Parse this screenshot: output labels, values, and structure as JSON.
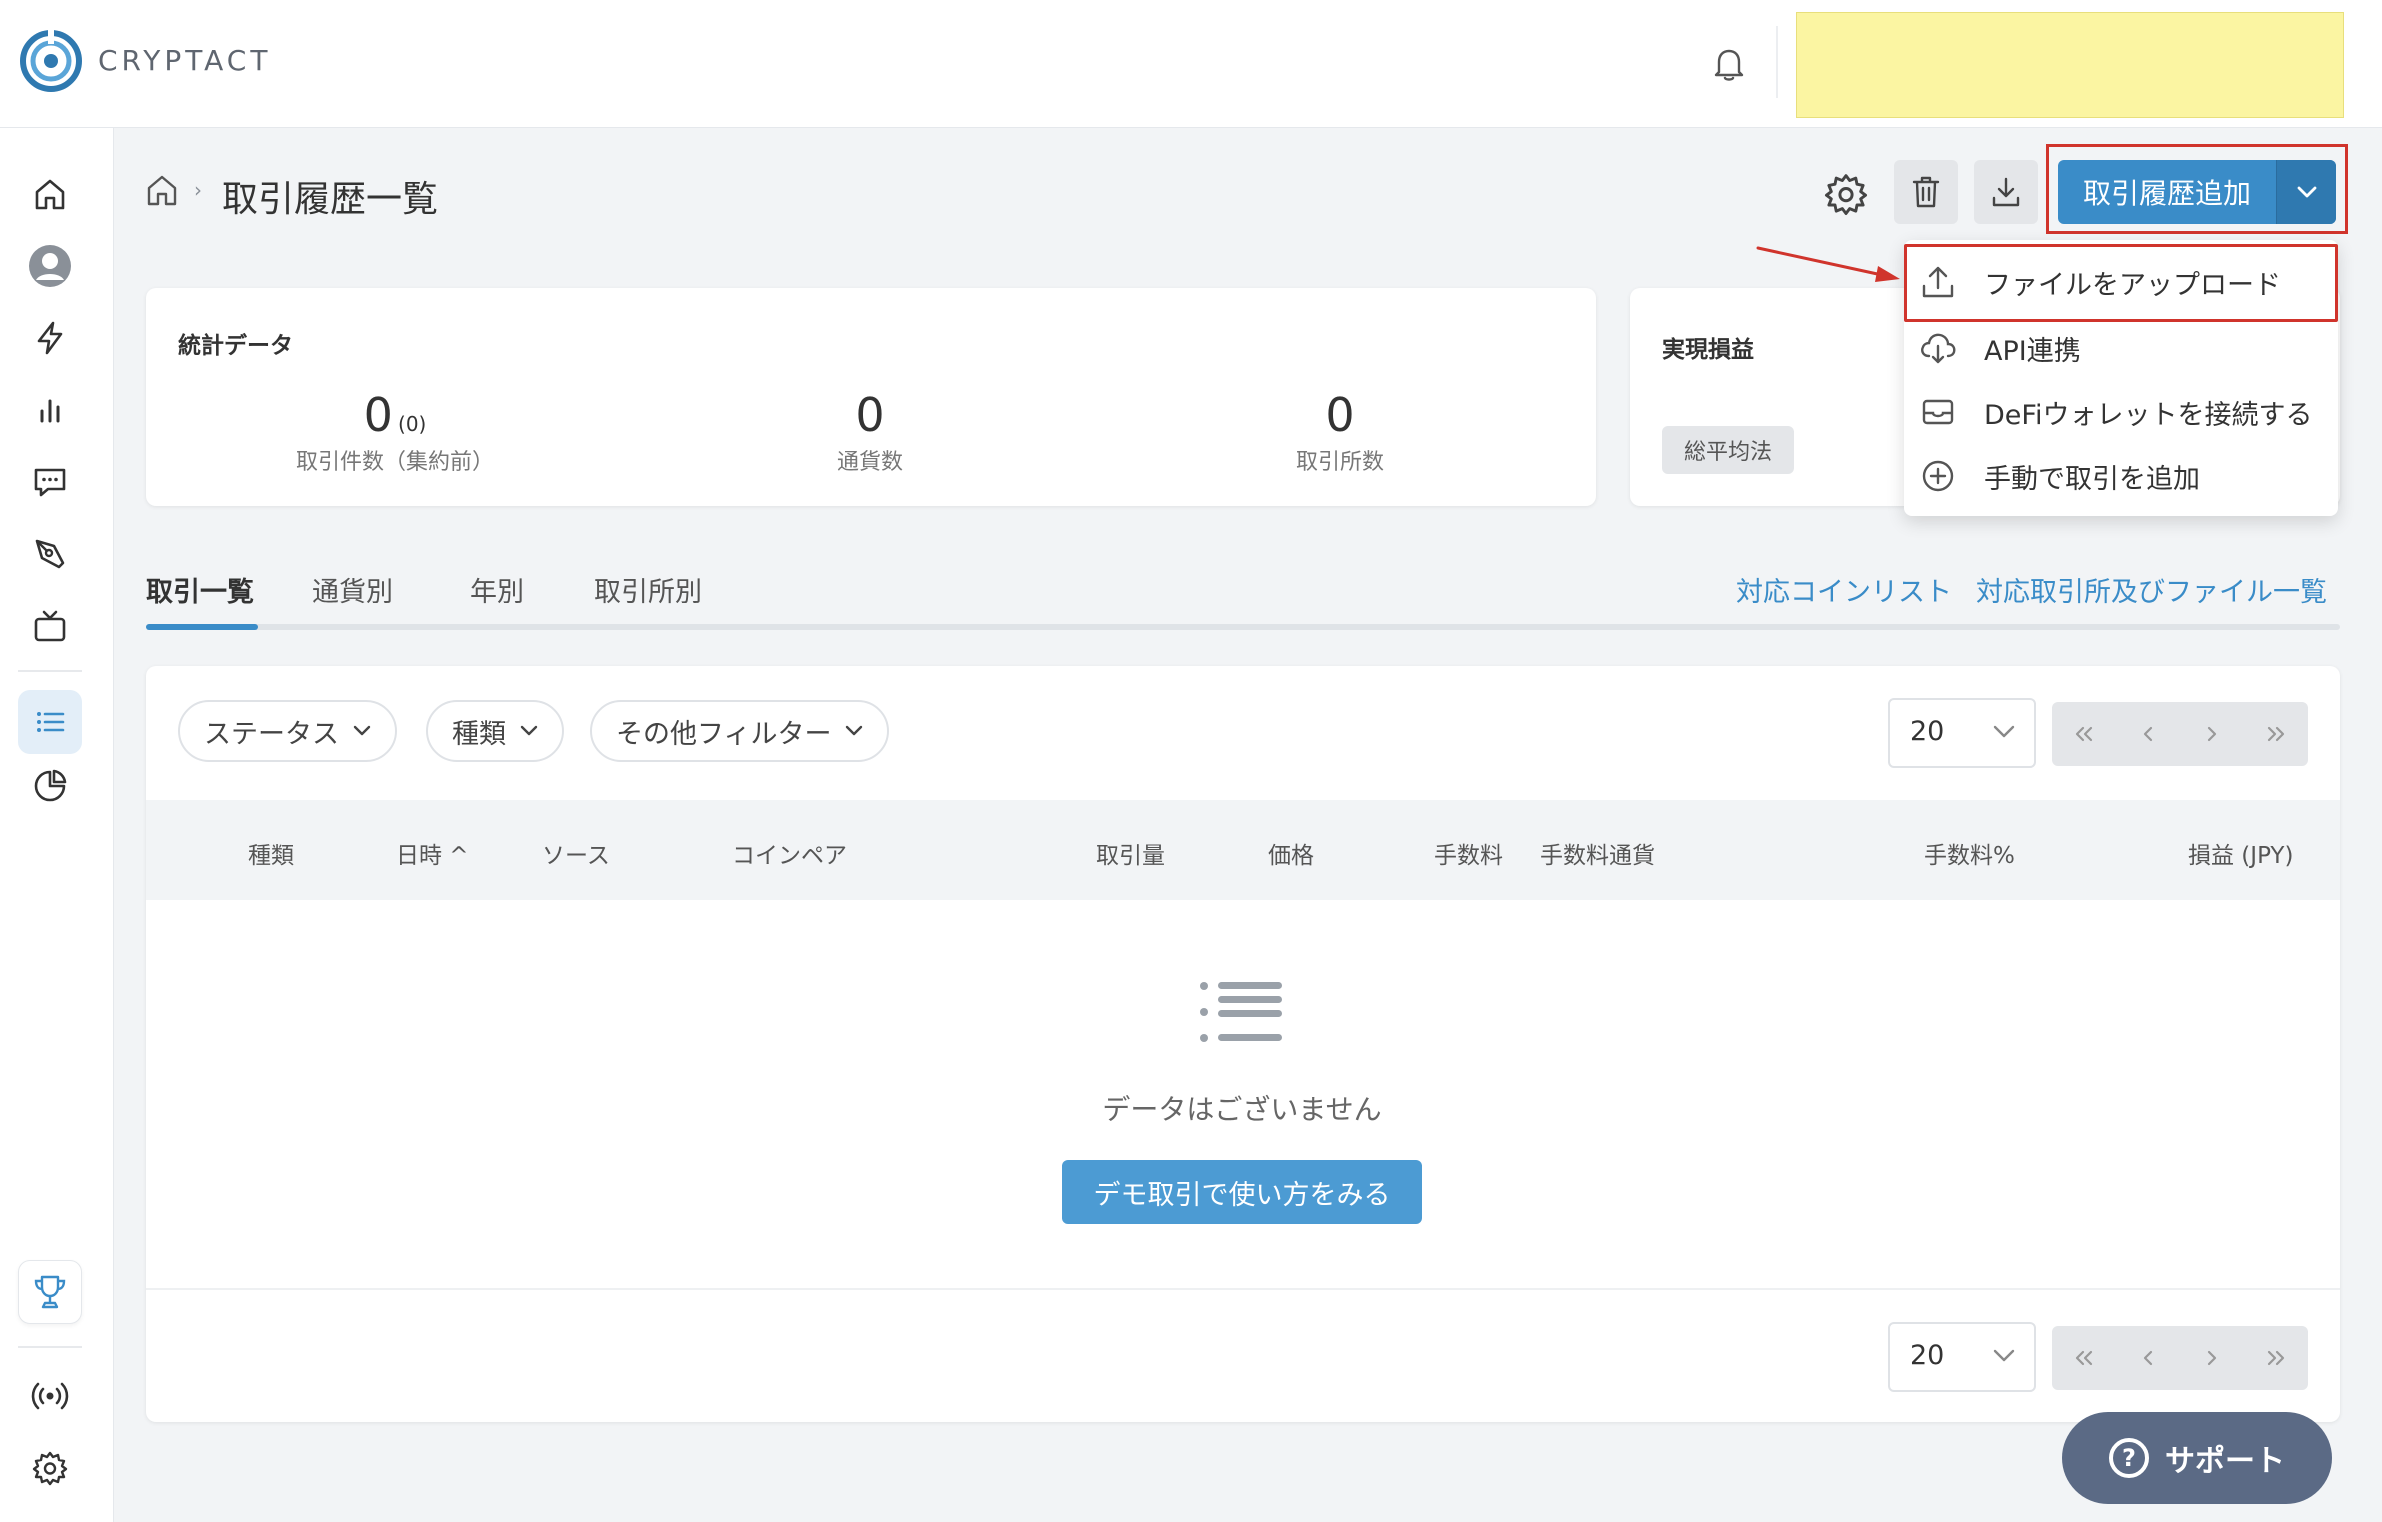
{
  "brand": {
    "name": "CRYPTACT"
  },
  "breadcrumb": {
    "title": "取引履歴一覧"
  },
  "toolbar": {
    "add_button_label": "取引履歴追加"
  },
  "add_menu": {
    "items": [
      {
        "label": "ファイルをアップロード",
        "icon": "upload-icon"
      },
      {
        "label": "API連携",
        "icon": "cloud-download-icon"
      },
      {
        "label": "DeFiウォレットを接続する",
        "icon": "wallet-icon"
      },
      {
        "label": "手動で取引を追加",
        "icon": "plus-circle-icon"
      }
    ]
  },
  "stats_card": {
    "title": "統計データ",
    "stats": [
      {
        "value": "0",
        "sub": "(0)",
        "label": "取引件数（集約前）"
      },
      {
        "value": "0",
        "label": "通貨数"
      },
      {
        "value": "0",
        "label": "取引所数"
      }
    ]
  },
  "pnl_card": {
    "title": "実現損益",
    "method": "総平均法"
  },
  "tabs": [
    {
      "label": "取引一覧",
      "active": true
    },
    {
      "label": "通貨別",
      "active": false
    },
    {
      "label": "年別",
      "active": false
    },
    {
      "label": "取引所別",
      "active": false
    }
  ],
  "links": {
    "coin_list": "対応コインリスト",
    "exchange_list": "対応取引所及びファイル一覧"
  },
  "filters": [
    {
      "label": "ステータス"
    },
    {
      "label": "種類"
    },
    {
      "label": "その他フィルター"
    }
  ],
  "page_size": "20",
  "table": {
    "columns": [
      "種類",
      "日時 ^",
      "ソース",
      "コインペア",
      "取引量",
      "価格",
      "手数料",
      "手数料通貨",
      "手数料%",
      "損益 (JPY)"
    ]
  },
  "empty_state": {
    "message": "データはございません",
    "demo_button": "デモ取引で使い方をみる"
  },
  "support": {
    "label": "サポート",
    "glyph": "?"
  },
  "colors": {
    "accent": "#3a8cc8",
    "highlight_red": "#d0342c",
    "sticky_note": "#fbf5a2",
    "support_bg": "#5b6a85"
  }
}
